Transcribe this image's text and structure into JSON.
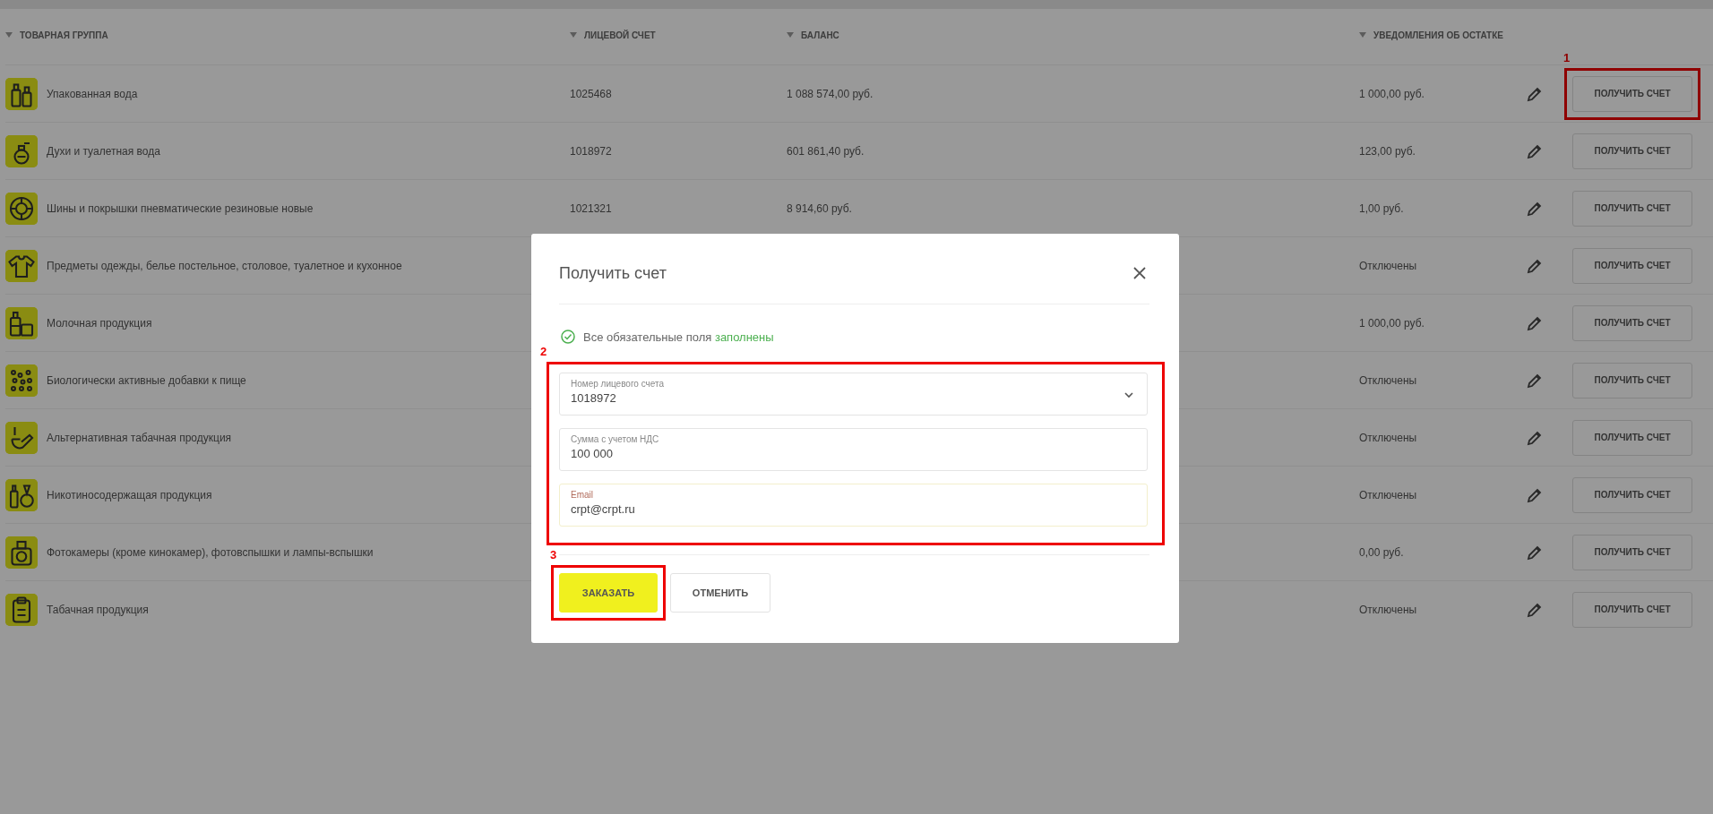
{
  "table": {
    "columns": [
      {
        "label": "ТОВАРНАЯ ГРУППА"
      },
      {
        "label": "ЛИЦЕВОЙ СЧЕТ"
      },
      {
        "label": "БАЛАНС"
      },
      {
        "label": "УВЕДОМЛЕНИЯ ОБ ОСТАТКЕ"
      }
    ],
    "rows": [
      {
        "name": "Упакованная вода",
        "account": "1025468",
        "balance": "1 088 574,00 руб.",
        "notification": "1 000,00 руб.",
        "button": "ПОЛУЧИТЬ СЧЕТ",
        "annotation": "1"
      },
      {
        "name": "Духи и туалетная вода",
        "account": "1018972",
        "balance": "601 861,40 руб.",
        "notification": "123,00 руб.",
        "button": "ПОЛУЧИТЬ СЧЕТ"
      },
      {
        "name": "Шины и покрышки пневматические резиновые новые",
        "account": "1021321",
        "balance": "8 914,60 руб.",
        "notification": "1,00 руб.",
        "button": "ПОЛУЧИТЬ СЧЕТ"
      },
      {
        "name": "Предметы одежды, белье постельное, столовое, туалетное и кухонное",
        "notification": "Отключены",
        "button": "ПОЛУЧИТЬ СЧЕТ"
      },
      {
        "name": "Молочная продукция",
        "notification": "1 000,00 руб.",
        "button": "ПОЛУЧИТЬ СЧЕТ"
      },
      {
        "name": "Биологически активные добавки к пище",
        "notification": "Отключены",
        "button": "ПОЛУЧИТЬ СЧЕТ"
      },
      {
        "name": "Альтернативная табачная продукция",
        "notification": "Отключены",
        "button": "ПОЛУЧИТЬ СЧЕТ"
      },
      {
        "name": "Никотиносодержащая продукция",
        "notification": "Отключены",
        "button": "ПОЛУЧИТЬ СЧЕТ"
      },
      {
        "name": "Фотокамеры (кроме кинокамер), фотовспышки и лампы-вспышки",
        "notification": "0,00 руб.",
        "button": "ПОЛУЧИТЬ СЧЕТ"
      },
      {
        "name": "Табачная продукция",
        "notification": "Отключены",
        "button": "ПОЛУЧИТЬ СЧЕТ"
      }
    ]
  },
  "modal": {
    "title": "Получить счет",
    "status": {
      "text": "Все обязательные поля",
      "highlight": "заполнены"
    },
    "fields_annotation": "2",
    "fields": [
      {
        "kind": "select",
        "label": "Номер лицевого счета",
        "value": "1018972"
      },
      {
        "kind": "text",
        "label": "Сумма с учетом НДС",
        "value": "100 000"
      },
      {
        "kind": "autofill",
        "label": "Email",
        "value": "crpt@crpt.ru"
      }
    ],
    "buttons": [
      {
        "kind": "primary",
        "label": "ЗАКАЗАТЬ",
        "annotation": "3"
      },
      {
        "kind": "secondary",
        "label": "ОТМЕНИТЬ"
      }
    ]
  }
}
